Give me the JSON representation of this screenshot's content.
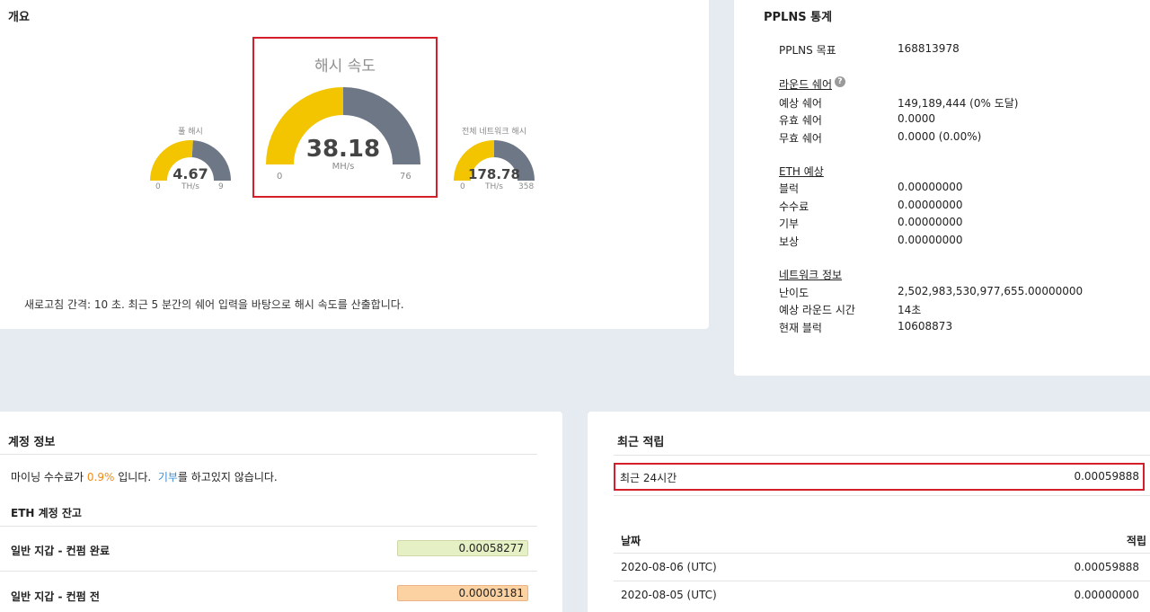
{
  "overview": {
    "title": "개요",
    "refresh_note": "새로고침 간격: 10 초. 최근 5 분간의 쉐어 입력을 바탕으로 해시 속도를 산출합니다.",
    "gauges": [
      {
        "id": "pool",
        "title": "풀 해시",
        "value": "4.67",
        "unit": "TH/s",
        "min": "0",
        "max": "9",
        "fill_fraction": 0.52
      },
      {
        "id": "user",
        "title": "해시 속도",
        "value": "38.18",
        "unit": "MH/s",
        "min": "0",
        "max": "76",
        "fill_fraction": 0.5
      },
      {
        "id": "network",
        "title": "전체 네트워크 해시",
        "value": "178.78",
        "unit": "TH/s",
        "min": "0",
        "max": "358",
        "fill_fraction": 0.5
      }
    ],
    "colors": {
      "gauge_fill": "#f2c500",
      "gauge_track": "#6e7785",
      "highlight": "#d41f2a"
    }
  },
  "pplns": {
    "title": "PPLNS 통계",
    "target_label": "PPLNS 목표",
    "target_value": "168813978",
    "round_shares": {
      "heading": "라운드 쉐어",
      "rows": [
        {
          "label": "예상 쉐어",
          "value": "149,189,444 (0% 도달)"
        },
        {
          "label": "유효 쉐어",
          "value": "0.0000"
        },
        {
          "label": "무효 쉐어",
          "value": "0.0000 (0.00%)"
        }
      ]
    },
    "eth_estimate": {
      "heading": "ETH 예상",
      "rows": [
        {
          "label": "블럭",
          "value": "0.00000000"
        },
        {
          "label": "수수료",
          "value": "0.00000000"
        },
        {
          "label": "기부",
          "value": "0.00000000"
        },
        {
          "label": "보상",
          "value": "0.00000000"
        }
      ]
    },
    "network_info": {
      "heading": "네트워크 정보",
      "rows": [
        {
          "label": "난이도",
          "value": "2,502,983,530,977,655.00000000"
        },
        {
          "label": "예상 라운드 시간",
          "value": "14초"
        },
        {
          "label": "현재 블럭",
          "value": "10608873"
        }
      ]
    }
  },
  "account": {
    "title": "계정 정보",
    "fee_prefix": "마이닝 수수료가 ",
    "fee_value": "0.9%",
    "fee_mid": " 입니다.  ",
    "donate_link": "기부",
    "fee_suffix": "를 하고있지 않습니다.",
    "balance_heading": "ETH 계정 잔고",
    "balances": [
      {
        "label": "일반 지갑 - 컨펌 완료",
        "value": "0.00058277",
        "color": "#e5f0c4"
      },
      {
        "label": "일반 지갑 - 컨펌 전",
        "value": "0.00003181",
        "color": "#fdd2a3"
      }
    ]
  },
  "recent": {
    "title": "최근 적립",
    "last24_label": "최근 24시간",
    "last24_value": "0.00059888",
    "col_date": "날짜",
    "col_amount": "적립",
    "rows": [
      {
        "date": "2020-08-06 (UTC)",
        "amount": "0.00059888"
      },
      {
        "date": "2020-08-05 (UTC)",
        "amount": "0.00000000"
      }
    ]
  }
}
